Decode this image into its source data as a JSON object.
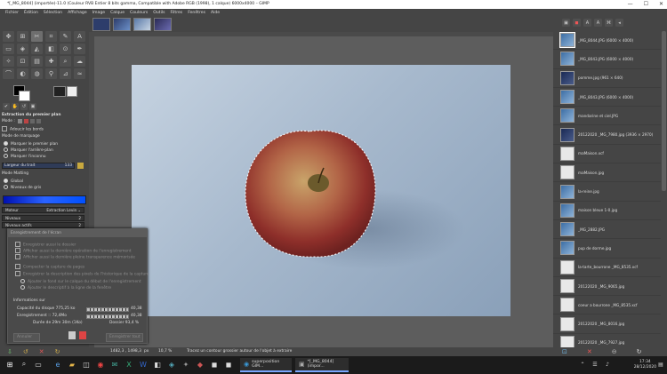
{
  "window": {
    "title": "*[_MG_8044] (importée)-11.0 (Couleur RVB Entier 8 bits gamma, Compatible with Adobe RGB (1998), 1 calque) 6000x4000 – GIMP",
    "minimize": "—",
    "maximize": "☐",
    "close": "✕"
  },
  "menu": [
    "Fichier",
    "Édition",
    "Sélection",
    "Affichage",
    "Image",
    "Calque",
    "Couleurs",
    "Outils",
    "Filtres",
    "Fenêtres",
    "Aide"
  ],
  "tool_options": {
    "title": "Extraction du premier plan",
    "mode_label": "Mode :",
    "antialias": "Adoucir les bords",
    "draw_mode_title": "Mode de marquage",
    "draw_modes": [
      "Marquer le premier plan",
      "Marquer l'arrière-plan",
      "Marquer l'inconnu"
    ],
    "stroke_width_label": "Largeur du trait",
    "stroke_width_value": "133",
    "matting_mode_title": "Mode Matting",
    "matting_modes": [
      "Global",
      "Niveaux de gris"
    ],
    "engine_label": "Moteur",
    "engine_value": "Extraction Levin",
    "levels_label": "Niveaux",
    "levels_value": "2",
    "active_levels_label": "Niveaux actifs",
    "active_levels_value": "2"
  },
  "dialog": {
    "title": "Enregistrement de l'écran",
    "options": [
      "Enregistrer aussi le dossier",
      "Afficher aussi la dernière opération de l'enregistrement",
      "Afficher aussi la dernière pleine transparence mémorisée",
      "Compacter la capture de pages",
      "Enregistrer la description des pixels de l'historique de la capture",
      "Ajouter le fond sur le calque du début de l'enregistrement",
      "Ajouter le descriptif à la ligne de la fenêtre"
    ],
    "info_title": "Informations sur",
    "rows": [
      {
        "label": "Capacité du disque 775,25 ko",
        "value": "40,38"
      },
      {
        "label": "Enregistrement :: 72,4Mo",
        "value": "40,38"
      },
      {
        "label": "Durée de 29m 30m (1Ko)",
        "value": "Dossier 93,4 %"
      }
    ],
    "cancel_label": "Annuler",
    "save_label": "Enregistrer tout"
  },
  "status": {
    "coords": "1482,3 , 1498,3",
    "unit": "px",
    "zoom": "10,7 %",
    "message": "Tracez un contour grossier autour de l'objet à extraire"
  },
  "documents": [
    {
      "label": "_MG_8044.JPG (6000 × 4000)",
      "thumb": "img",
      "selected": true
    },
    {
      "label": "_MG_8043.JPG (6000 × 4000)",
      "thumb": "img",
      "selected": false
    },
    {
      "label": "pomme.jpg (961 × 640)",
      "thumb": "dark",
      "selected": false
    },
    {
      "label": "_MG_8043.JPG (6000 × 4000)",
      "thumb": "img",
      "selected": false
    },
    {
      "label": "mandarine et ciel.JPG",
      "thumb": "img",
      "selected": false
    },
    {
      "label": "20122020 _MG_7980.jpg (3936 × 2970)",
      "thumb": "dark",
      "selected": false
    },
    {
      "label": "maMaison.xcf",
      "thumb": "doc",
      "selected": false
    },
    {
      "label": "maMaison.jpg",
      "thumb": "doc",
      "selected": false
    },
    {
      "label": "la-reine.jpg",
      "thumb": "img",
      "selected": false
    },
    {
      "label": "maison bleue 1-0.jpg",
      "thumb": "img",
      "selected": false
    },
    {
      "label": "_MG_2882.JPG",
      "thumb": "img",
      "selected": false
    },
    {
      "label": "pup de dorme.jpg",
      "thumb": "img",
      "selected": false
    },
    {
      "label": "la-tarte_bourrone _MG_8535.xcf",
      "thumb": "doc",
      "selected": false
    },
    {
      "label": "20122020 _MG_9065.jpg",
      "thumb": "doc",
      "selected": false
    },
    {
      "label": "coeur a bourrone _MG_8535.xcf",
      "thumb": "doc",
      "selected": false
    },
    {
      "label": "20122020 _MG_8016.jpg",
      "thumb": "doc",
      "selected": false
    },
    {
      "label": "20122020 _MG_7927.jpg",
      "thumb": "doc",
      "selected": false
    },
    {
      "label": "les-pyrénées.png.jpg",
      "thumb": "doc",
      "selected": false
    }
  ],
  "taskbar": {
    "apps": [
      {
        "label": "superposition GIM..."
      },
      {
        "label": "*[_MG_8044] (impor..."
      }
    ],
    "time": "17:34",
    "date": "28/12/2020"
  }
}
